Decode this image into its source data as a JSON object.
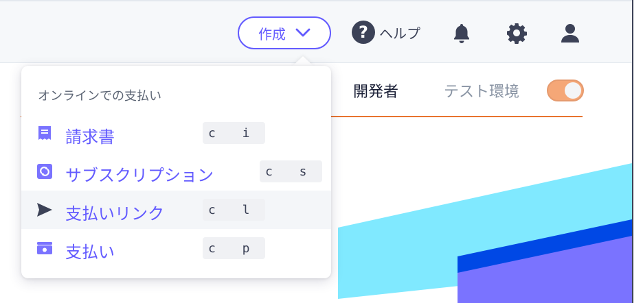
{
  "header": {
    "create_label": "作成",
    "help_label": "ヘルプ"
  },
  "nav": {
    "developers_label": "開発者",
    "test_env_label": "テスト環境",
    "test_mode_on": true
  },
  "dropdown": {
    "section_title": "オンラインでの支払い",
    "items": [
      {
        "label": "請求書",
        "shortcut": "c i",
        "icon": "invoice-icon"
      },
      {
        "label": "サブスクリプション",
        "shortcut": "c s",
        "icon": "subscription-icon"
      },
      {
        "label": "支払いリンク",
        "shortcut": "c l",
        "icon": "send-icon"
      },
      {
        "label": "支払い",
        "shortcut": "c p",
        "icon": "wallet-icon"
      }
    ]
  },
  "colors": {
    "accent": "#635bff",
    "test_toggle": "#f5a777",
    "divider": "#e8732f",
    "deco_cyan": "#80e9ff",
    "deco_blue": "#0048e5",
    "deco_purple": "#7a73ff"
  }
}
